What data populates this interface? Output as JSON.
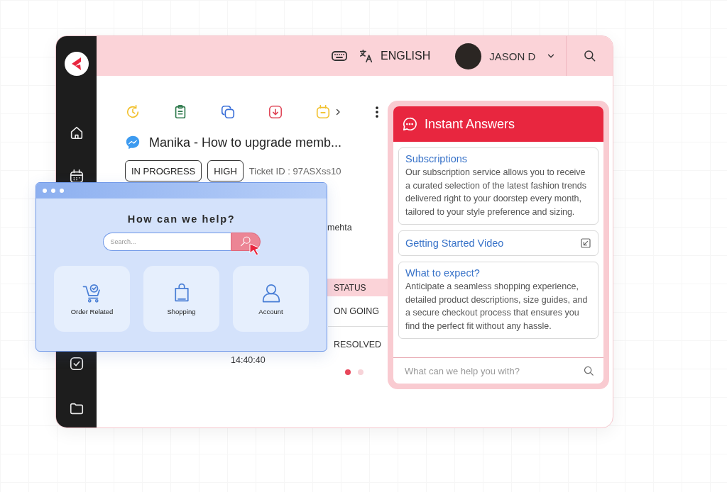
{
  "header": {
    "language": "ENGLISH",
    "user_name": "JASON D"
  },
  "ticket": {
    "title": "Manika - How to upgrade memb...",
    "tags": [
      "IN PROGRESS",
      "HIGH"
    ],
    "ticket_id": "Ticket ID : 97ASXss10",
    "assignee_partial": "mehta"
  },
  "table": {
    "columns": [
      "STATUS"
    ],
    "rows": [
      {
        "time": "",
        "status": "ON GOING"
      },
      {
        "time": "14:40:40",
        "status": "RESOLVED"
      }
    ]
  },
  "pagination": [
    {
      "selected": true
    },
    {
      "selected": false
    }
  ],
  "instant_answers": {
    "title": "Instant Answers",
    "cards": [
      {
        "kind": "article",
        "title": "Subscriptions",
        "body": "Our subscription service allows you to receive a curated selection of the latest fashion trends delivered right to your doorstep every month, tailored to your style preference and sizing."
      },
      {
        "kind": "video",
        "title": "Getting Started Video"
      },
      {
        "kind": "article",
        "title": "What to expect?",
        "body": "Anticipate a seamless shopping experience, detailed product descriptions, size guides, and a secure checkout process that ensures you find the perfect fit without any hassle."
      }
    ],
    "input_placeholder": "What can we help you with?"
  },
  "help_window": {
    "title": "How can we help?",
    "search_placeholder": "Search...",
    "categories": [
      {
        "kind": "order",
        "label": "Order Related"
      },
      {
        "kind": "shopping",
        "label": "Shopping"
      },
      {
        "kind": "account",
        "label": "Account"
      }
    ]
  }
}
